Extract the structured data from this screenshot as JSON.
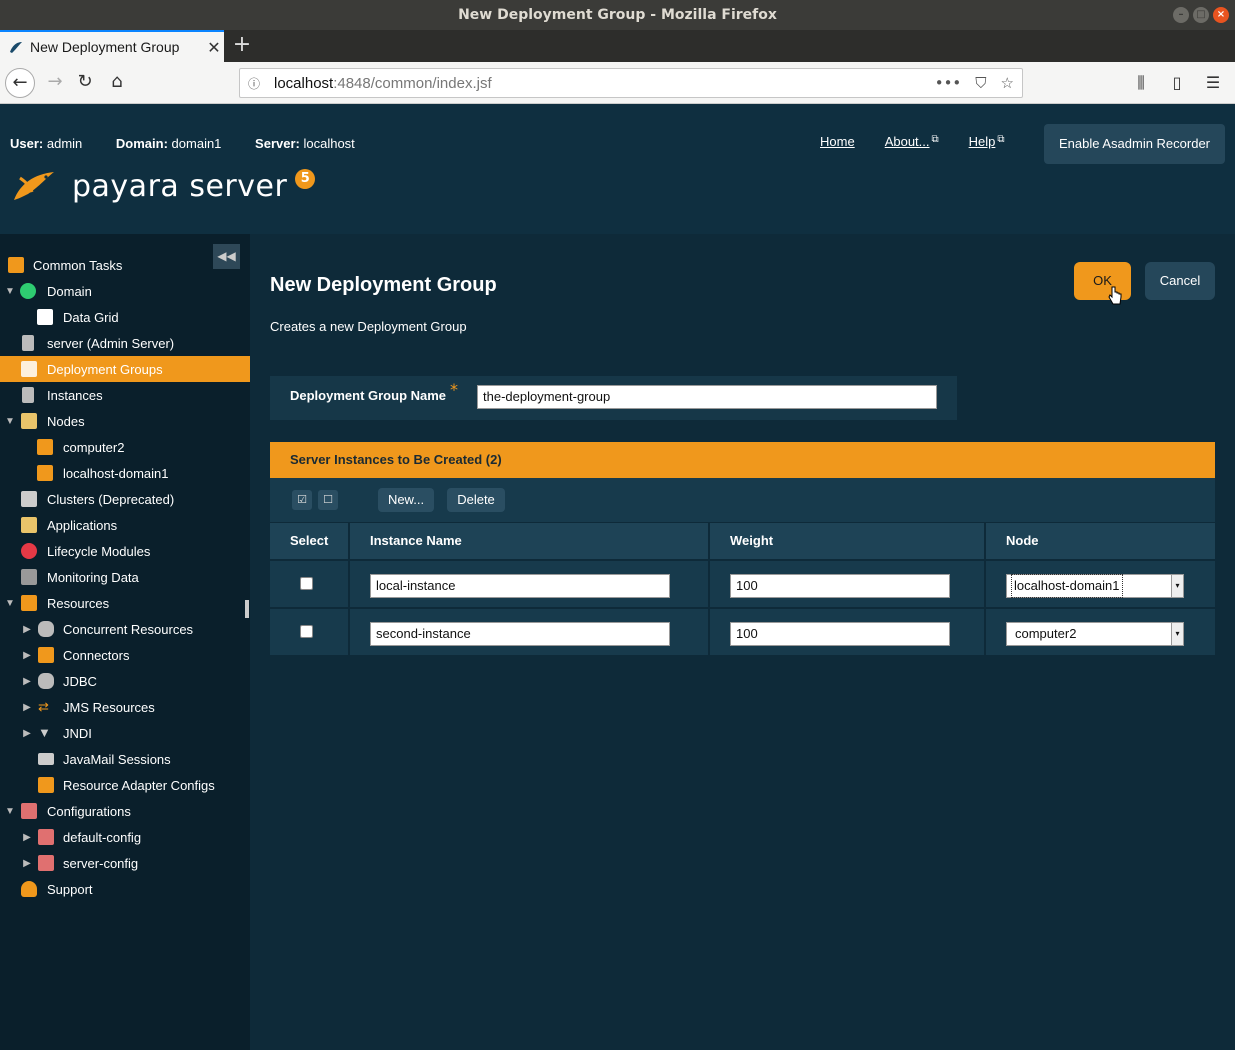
{
  "window": {
    "title": "New Deployment Group - Mozilla Firefox"
  },
  "browser": {
    "tab_title": "New Deployment Group",
    "url_host": "localhost",
    "url_path": ":4848/common/index.jsf"
  },
  "header": {
    "user_label": "User:",
    "user_value": "admin",
    "domain_label": "Domain:",
    "domain_value": "domain1",
    "server_label": "Server:",
    "server_value": "localhost",
    "links": [
      "Home",
      "About...",
      "Help"
    ],
    "asadmin_button": "Enable Asadmin Recorder",
    "logo_text": "payara server",
    "logo_version": "5"
  },
  "sidebar": {
    "items": [
      {
        "label": "Common Tasks",
        "icon": "tasks-icon"
      },
      {
        "label": "Domain",
        "icon": "globe-icon"
      },
      {
        "label": "Data Grid",
        "icon": "grid-icon"
      },
      {
        "label": "server (Admin Server)",
        "icon": "server-icon"
      },
      {
        "label": "Deployment Groups",
        "icon": "hierarchy-icon"
      },
      {
        "label": "Instances",
        "icon": "server-icon"
      },
      {
        "label": "Nodes",
        "icon": "monitor-icon"
      },
      {
        "label": "computer2",
        "icon": "node-icon"
      },
      {
        "label": "localhost-domain1",
        "icon": "node-icon"
      },
      {
        "label": "Clusters (Deprecated)",
        "icon": "hierarchy-icon"
      },
      {
        "label": "Applications",
        "icon": "applications-icon"
      },
      {
        "label": "Lifecycle Modules",
        "icon": "lifecycle-icon"
      },
      {
        "label": "Monitoring Data",
        "icon": "monitor-icon"
      },
      {
        "label": "Resources",
        "icon": "folder-icon"
      },
      {
        "label": "Concurrent Resources",
        "icon": "database-icon"
      },
      {
        "label": "Connectors",
        "icon": "puzzle-icon"
      },
      {
        "label": "JDBC",
        "icon": "database-icon"
      },
      {
        "label": "JMS Resources",
        "icon": "exchange-icon"
      },
      {
        "label": "JNDI",
        "icon": "funnel-icon"
      },
      {
        "label": "JavaMail Sessions",
        "icon": "mail-icon"
      },
      {
        "label": "Resource Adapter Configs",
        "icon": "puzzle-icon"
      },
      {
        "label": "Configurations",
        "icon": "config-icon"
      },
      {
        "label": "default-config",
        "icon": "config-icon"
      },
      {
        "label": "server-config",
        "icon": "config-icon"
      },
      {
        "label": "Support",
        "icon": "person-icon"
      }
    ]
  },
  "page": {
    "title": "New Deployment Group",
    "description": "Creates a new Deployment Group",
    "ok_button": "OK",
    "cancel_button": "Cancel",
    "name_label": "Deployment Group Name",
    "name_required": "*",
    "name_value": "the-deployment-group"
  },
  "table": {
    "title": "Server Instances to Be Created (2)",
    "new_button": "New...",
    "delete_button": "Delete",
    "columns": [
      "Select",
      "Instance Name",
      "Weight",
      "Node"
    ],
    "rows": [
      {
        "instance_name": "local-instance",
        "weight": "100",
        "node": "localhost-domain1"
      },
      {
        "instance_name": "second-instance",
        "weight": "100",
        "node": "computer2"
      }
    ]
  },
  "colors": {
    "accent": "#f0981c",
    "header_bg": "#0f2f40",
    "sidebar_bg": "#0a1f2b",
    "main_bg": "#0e2a39"
  }
}
